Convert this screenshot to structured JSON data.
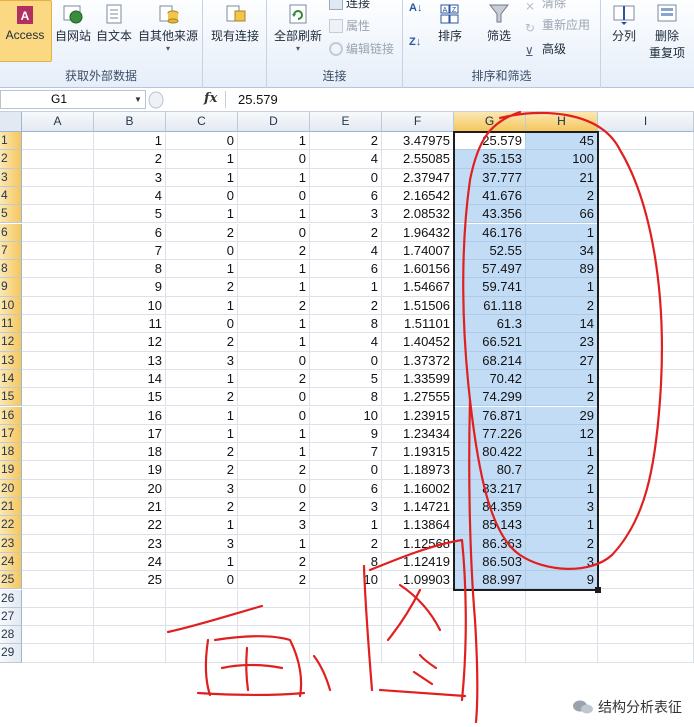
{
  "ribbon": {
    "get_external": {
      "label": "获取外部数据",
      "access": "Access",
      "web": "自网站",
      "text": "自文本",
      "other": "自其他来源"
    },
    "existing_conn": "现有连接",
    "connections": {
      "label": "连接",
      "refresh_all": "全部刷新",
      "connections": "连接",
      "properties": "属性",
      "edit_links": "编辑链接"
    },
    "sort_filter": {
      "label": "排序和筛选",
      "sort": "排序",
      "filter": "筛选",
      "clear": "清除",
      "reapply": "重新应用",
      "advanced": "高级"
    },
    "data_tools": {
      "text_to_columns": "分列",
      "remove_dup_line1": "删除",
      "remove_dup_line2": "重复项"
    }
  },
  "formula_bar": {
    "name_box": "G1",
    "fx": "fx",
    "value": "25.579"
  },
  "columns": [
    "A",
    "B",
    "C",
    "D",
    "E",
    "F",
    "G",
    "H",
    "I"
  ],
  "row_numbers": [
    "1",
    "2",
    "3",
    "4",
    "5",
    "6",
    "7",
    "8",
    "9",
    "10",
    "11",
    "12",
    "13",
    "14",
    "15",
    "16",
    "17",
    "18",
    "19",
    "20",
    "21",
    "22",
    "23",
    "24",
    "25",
    "26",
    "27",
    "28",
    "29"
  ],
  "rows": [
    [
      "",
      "1",
      "0",
      "1",
      "2",
      "3.47975",
      "25.579",
      "45"
    ],
    [
      "",
      "2",
      "1",
      "0",
      "4",
      "2.55085",
      "35.153",
      "100"
    ],
    [
      "",
      "3",
      "1",
      "1",
      "0",
      "2.37947",
      "37.777",
      "21"
    ],
    [
      "",
      "4",
      "0",
      "0",
      "6",
      "2.16542",
      "41.676",
      "2"
    ],
    [
      "",
      "5",
      "1",
      "1",
      "3",
      "2.08532",
      "43.356",
      "66"
    ],
    [
      "",
      "6",
      "2",
      "0",
      "2",
      "1.96432",
      "46.176",
      "1"
    ],
    [
      "",
      "7",
      "0",
      "2",
      "4",
      "1.74007",
      "52.55",
      "34"
    ],
    [
      "",
      "8",
      "1",
      "1",
      "6",
      "1.60156",
      "57.497",
      "89"
    ],
    [
      "",
      "9",
      "2",
      "1",
      "1",
      "1.54667",
      "59.741",
      "1"
    ],
    [
      "",
      "10",
      "1",
      "2",
      "2",
      "1.51506",
      "61.118",
      "2"
    ],
    [
      "",
      "11",
      "0",
      "1",
      "8",
      "1.51101",
      "61.3",
      "14"
    ],
    [
      "",
      "12",
      "2",
      "1",
      "4",
      "1.40452",
      "66.521",
      "23"
    ],
    [
      "",
      "13",
      "3",
      "0",
      "0",
      "1.37372",
      "68.214",
      "27"
    ],
    [
      "",
      "14",
      "1",
      "2",
      "5",
      "1.33599",
      "70.42",
      "1"
    ],
    [
      "",
      "15",
      "2",
      "0",
      "8",
      "1.27555",
      "74.299",
      "2"
    ],
    [
      "",
      "16",
      "1",
      "0",
      "10",
      "1.23915",
      "76.871",
      "29"
    ],
    [
      "",
      "17",
      "1",
      "1",
      "9",
      "1.23434",
      "77.226",
      "12"
    ],
    [
      "",
      "18",
      "2",
      "1",
      "7",
      "1.19315",
      "80.422",
      "1"
    ],
    [
      "",
      "19",
      "2",
      "2",
      "0",
      "1.18973",
      "80.7",
      "2"
    ],
    [
      "",
      "20",
      "3",
      "0",
      "6",
      "1.16002",
      "83.217",
      "1"
    ],
    [
      "",
      "21",
      "2",
      "2",
      "3",
      "1.14721",
      "84.359",
      "3"
    ],
    [
      "",
      "22",
      "1",
      "3",
      "1",
      "1.13864",
      "85.143",
      "1"
    ],
    [
      "",
      "23",
      "3",
      "1",
      "2",
      "1.12568",
      "86.363",
      "2"
    ],
    [
      "",
      "24",
      "1",
      "2",
      "8",
      "1.12419",
      "86.503",
      "3"
    ],
    [
      "",
      "25",
      "0",
      "2",
      "10",
      "1.09903",
      "88.997",
      "9"
    ]
  ],
  "watermark": "结构分析表征",
  "annotation_color": "#e02020",
  "selection_color": "#c3dcf6"
}
